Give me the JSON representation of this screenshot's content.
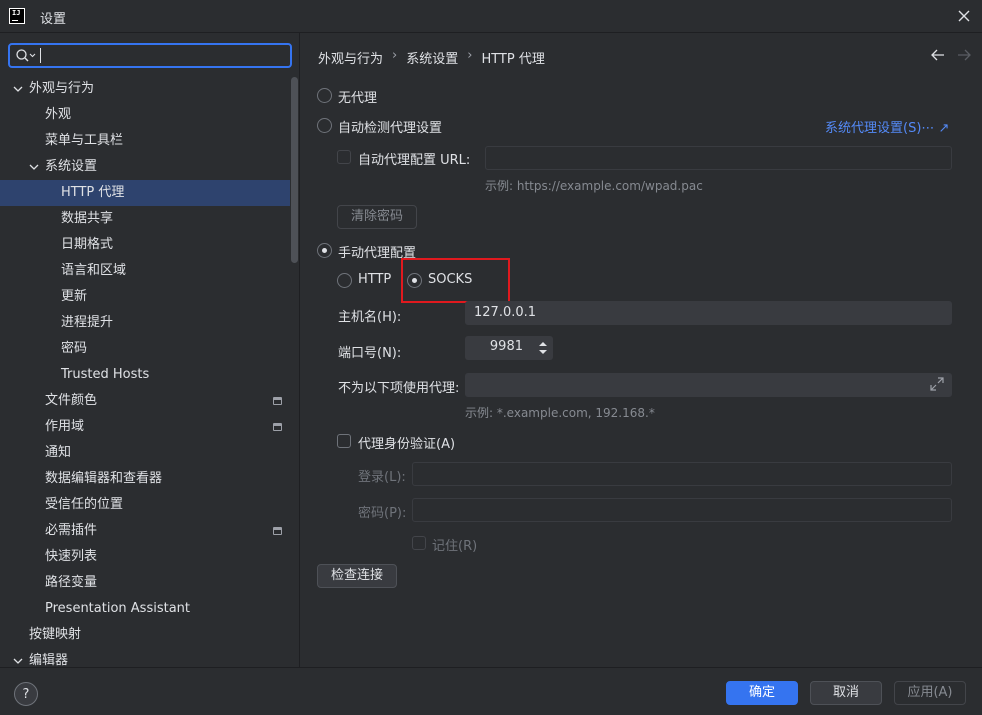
{
  "window": {
    "title": "设置"
  },
  "search": {
    "value": "",
    "placeholder": ""
  },
  "sidebar": {
    "items": [
      {
        "label": "外观与行为",
        "level": 0,
        "expandable": true,
        "expanded": true
      },
      {
        "label": "外观",
        "level": 1
      },
      {
        "label": "菜单与工具栏",
        "level": 1
      },
      {
        "label": "系统设置",
        "level": 1,
        "expandable": true,
        "expanded": true
      },
      {
        "label": "HTTP 代理",
        "level": 2,
        "selected": true
      },
      {
        "label": "数据共享",
        "level": 2
      },
      {
        "label": "日期格式",
        "level": 2
      },
      {
        "label": "语言和区域",
        "level": 2
      },
      {
        "label": "更新",
        "level": 2
      },
      {
        "label": "进程提升",
        "level": 2
      },
      {
        "label": "密码",
        "level": 2
      },
      {
        "label": "Trusted Hosts",
        "level": 2
      },
      {
        "label": "文件颜色",
        "level": 1,
        "project_icon": true
      },
      {
        "label": "作用域",
        "level": 1,
        "project_icon": true
      },
      {
        "label": "通知",
        "level": 1
      },
      {
        "label": "数据编辑器和查看器",
        "level": 1
      },
      {
        "label": "受信任的位置",
        "level": 1
      },
      {
        "label": "必需插件",
        "level": 1,
        "project_icon": true
      },
      {
        "label": "快速列表",
        "level": 1
      },
      {
        "label": "路径变量",
        "level": 1
      },
      {
        "label": "Presentation Assistant",
        "level": 1
      },
      {
        "label": "按键映射",
        "level": 0
      },
      {
        "label": "编辑器",
        "level": 0,
        "expandable": true,
        "expanded": true
      }
    ]
  },
  "breadcrumb": [
    "外观与行为",
    "系统设置",
    "HTTP 代理"
  ],
  "proxy": {
    "no_proxy": "无代理",
    "auto_detect": "自动检测代理设置",
    "system_proxy_link": "系统代理设置(S)⋯ ↗",
    "auto_config_url_label": "自动代理配置 URL:",
    "auto_config_url_value": "",
    "auto_config_hint": "示例: https://example.com/wpad.pac",
    "clear_password": "清除密码",
    "manual": "手动代理配置",
    "http": "HTTP",
    "socks": "SOCKS",
    "host_label": "主机名(H):",
    "host_value": "127.0.0.1",
    "port_label": "端口号(N):",
    "port_value": "9981",
    "no_proxy_for_label": "不为以下项使用代理:",
    "no_proxy_for_value": "",
    "no_proxy_for_hint": "示例: *.example.com, 192.168.*",
    "auth_label": "代理身份验证(A)",
    "login_label": "登录(L):",
    "password_label": "密码(P):",
    "remember_label": "记住(R)",
    "check_connection": "检查连接"
  },
  "footer": {
    "help": "?",
    "ok": "确定",
    "cancel": "取消",
    "apply": "应用(A)"
  },
  "colors": {
    "accent": "#3574f0",
    "selection": "#2e436e",
    "highlight": "#e0191e",
    "link": "#548af7"
  }
}
